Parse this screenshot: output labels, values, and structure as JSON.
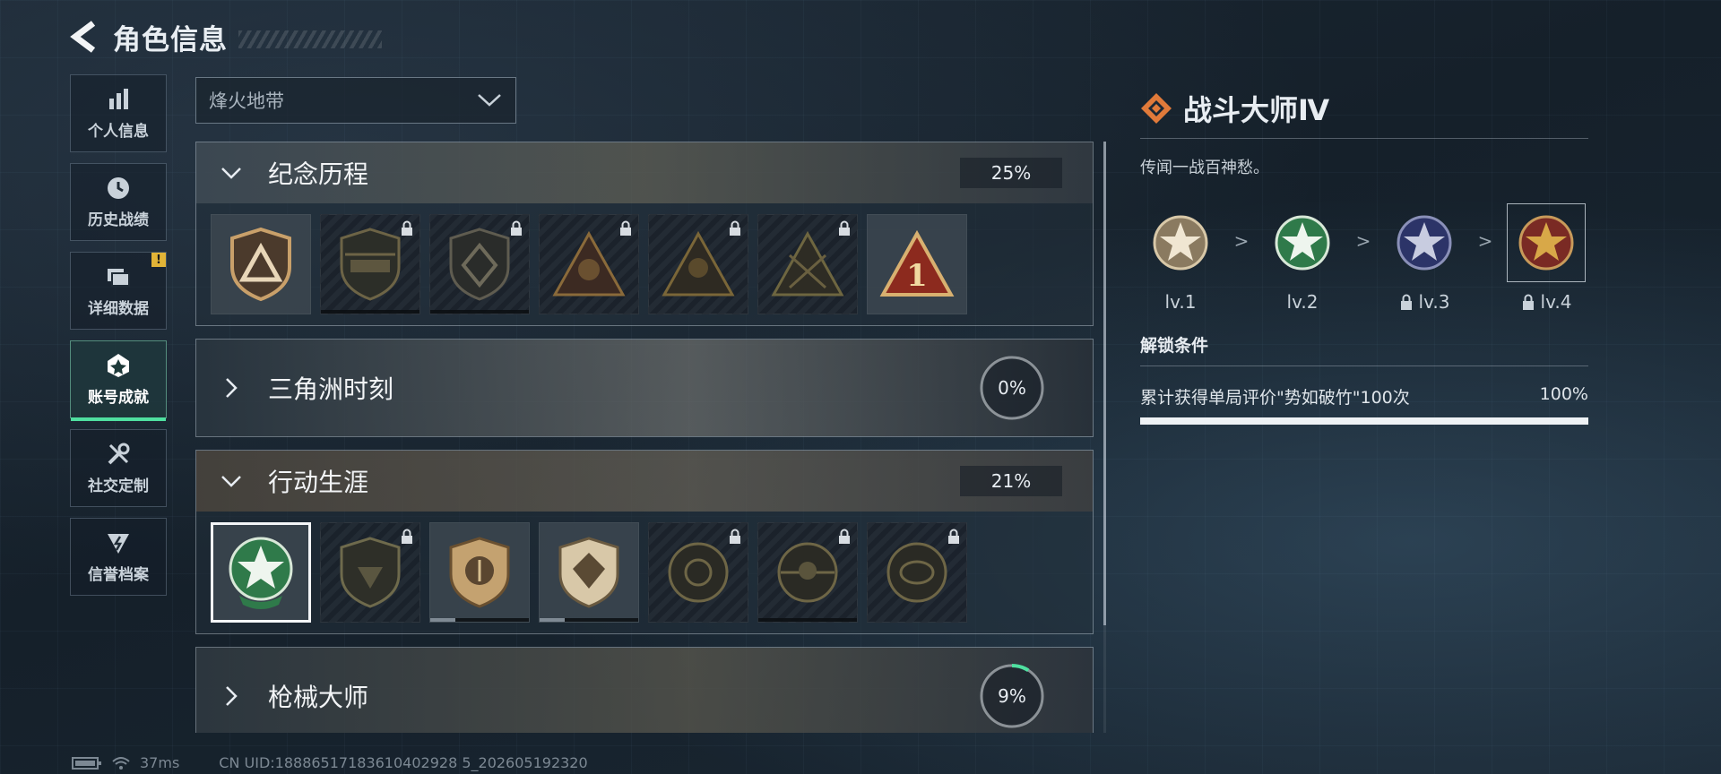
{
  "header": {
    "title": "角色信息"
  },
  "sidebar": {
    "items": [
      {
        "label": "个人信息",
        "icon": "bar-chart-icon"
      },
      {
        "label": "历史战绩",
        "icon": "clock-icon"
      },
      {
        "label": "详细数据",
        "icon": "folders-icon",
        "badge": "!"
      },
      {
        "label": "账号成就",
        "icon": "achievement-icon",
        "active": true
      },
      {
        "label": "社交定制",
        "icon": "tools-icon"
      },
      {
        "label": "信誉档案",
        "icon": "reputation-icon"
      }
    ]
  },
  "mode_select": {
    "value": "烽火地带"
  },
  "categories": [
    {
      "name": "纪念历程",
      "percent": "25%",
      "expanded": true
    },
    {
      "name": "三角洲时刻",
      "percent": "0%",
      "expanded": false
    },
    {
      "name": "行动生涯",
      "percent": "21%",
      "expanded": true
    },
    {
      "name": "枪械大师",
      "percent": "9%",
      "expanded": false
    }
  ],
  "progress_ring": {
    "c2": 0,
    "c4": 0.09
  },
  "detail": {
    "title": "战斗大师Ⅳ",
    "description": "传闻一战百神愁。",
    "levels": [
      {
        "label": "lv.1",
        "locked": false
      },
      {
        "label": "lv.2",
        "locked": false
      },
      {
        "label": "lv.3",
        "locked": true
      },
      {
        "label": "lv.4",
        "locked": true
      }
    ],
    "separator": ">",
    "condition_title": "解锁条件",
    "condition_text": "累计获得单局评价\"势如破竹\"100次",
    "condition_percent": "100%",
    "condition_progress": 1.0
  },
  "status": {
    "latency": "37ms",
    "uid": "CN UID:18886517183610402928 5_202605192320"
  },
  "colors": {
    "accent": "#4fe0a0",
    "warning": "#e2b437",
    "gold": "#c9a060"
  }
}
